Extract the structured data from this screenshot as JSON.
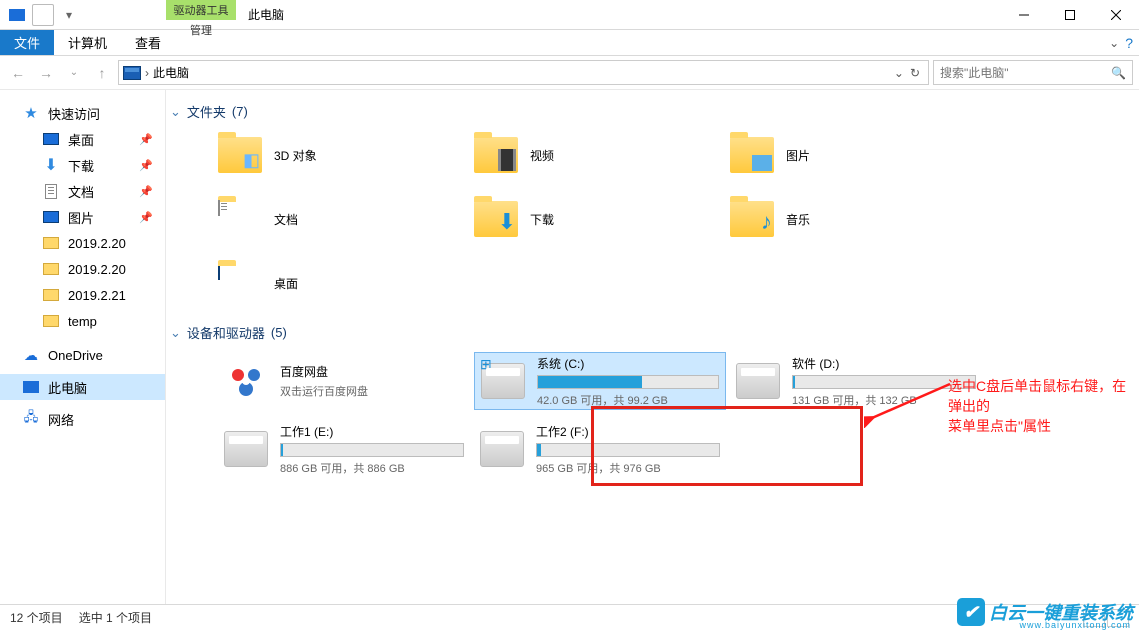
{
  "title": "此电脑",
  "driveToolsLabel": "驱动器工具",
  "manageLabel": "管理",
  "tabs": {
    "file": "文件",
    "computer": "计算机",
    "view": "查看"
  },
  "breadcrumb": {
    "root": "此电脑"
  },
  "search": {
    "placeholder": "搜索\"此电脑\""
  },
  "sidebar": {
    "quickAccess": "快速访问",
    "desktop": "桌面",
    "downloads": "下载",
    "documents": "文档",
    "pictures": "图片",
    "f1": "2019.2.20",
    "f2": "2019.2.20",
    "f3": "2019.2.21",
    "f4": "temp",
    "onedrive": "OneDrive",
    "thisPc": "此电脑",
    "network": "网络"
  },
  "groups": {
    "folders": {
      "label": "文件夹",
      "count": "(7)"
    },
    "devices": {
      "label": "设备和驱动器",
      "count": "(5)"
    }
  },
  "folders": {
    "obj3d": "3D 对象",
    "video": "视频",
    "pictures": "图片",
    "documents": "文档",
    "downloads": "下载",
    "music": "音乐",
    "desktop": "桌面"
  },
  "drives": {
    "baidu": {
      "name": "百度网盘",
      "sub": "双击运行百度网盘"
    },
    "c": {
      "name": "系统 (C:)",
      "sub": "42.0 GB 可用，共 99.2 GB",
      "fillPct": 58
    },
    "d": {
      "name": "软件 (D:)",
      "sub": "131 GB 可用，共 132 GB",
      "fillPct": 1
    },
    "e": {
      "name": "工作1 (E:)",
      "sub": "886 GB 可用，共 886 GB",
      "fillPct": 1
    },
    "f": {
      "name": "工作2 (F:)",
      "sub": "965 GB 可用，共 976 GB",
      "fillPct": 2
    }
  },
  "annotation": {
    "line1": "选中C盘后单击鼠标右键，在弹出的",
    "line2": "菜单里点击\"属性"
  },
  "status": {
    "count": "12 个项目",
    "sel": "选中 1 个项目"
  },
  "watermark": {
    "text": "白云一键重装系统",
    "url": "www.baiyunxitong.com"
  }
}
